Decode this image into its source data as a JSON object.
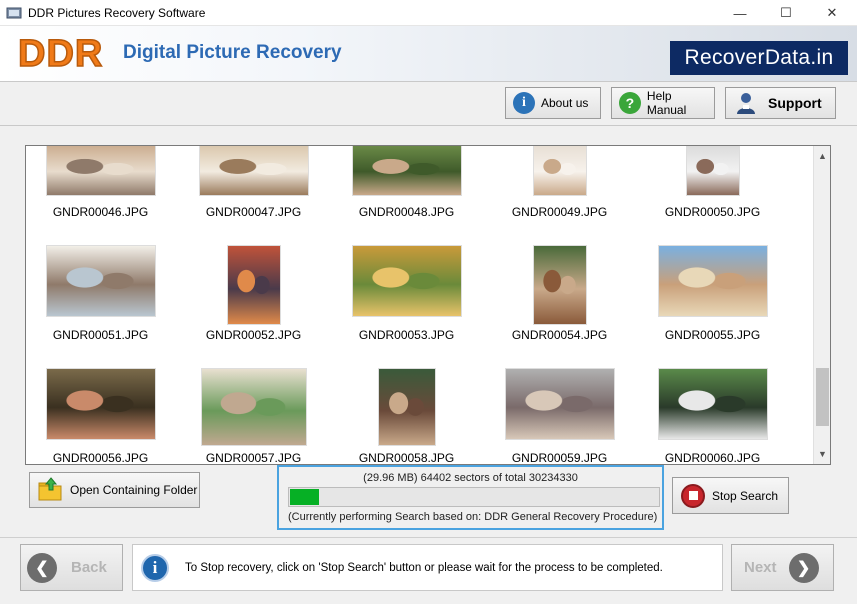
{
  "window": {
    "title": "DDR Pictures Recovery Software",
    "controls": {
      "minimize": "—",
      "maximize": "☐",
      "close": "✕"
    }
  },
  "banner": {
    "logo": "DDR",
    "product": "Digital Picture Recovery",
    "brand": "RecoverData.in",
    "logo_color": "#f07a18",
    "product_color": "#2d6ab4",
    "brand_bg": "#0d2a63"
  },
  "top_buttons": {
    "about": "About us",
    "help": "Help Manual",
    "support": "Support"
  },
  "gallery": {
    "rows": [
      [
        {
          "name": "GNDR00046.JPG",
          "icon": "photo-thumbnail"
        },
        {
          "name": "GNDR00047.JPG",
          "icon": "photo-thumbnail"
        },
        {
          "name": "GNDR00048.JPG",
          "icon": "photo-thumbnail"
        },
        {
          "name": "GNDR00049.JPG",
          "icon": "photo-thumbnail"
        },
        {
          "name": "GNDR00050.JPG",
          "icon": "photo-thumbnail"
        }
      ],
      [
        {
          "name": "GNDR00051.JPG",
          "icon": "photo-thumbnail"
        },
        {
          "name": "GNDR00052.JPG",
          "icon": "photo-thumbnail"
        },
        {
          "name": "GNDR00053.JPG",
          "icon": "photo-thumbnail"
        },
        {
          "name": "GNDR00054.JPG",
          "icon": "photo-thumbnail"
        },
        {
          "name": "GNDR00055.JPG",
          "icon": "photo-thumbnail"
        }
      ],
      [
        {
          "name": "GNDR00056.JPG",
          "icon": "photo-thumbnail"
        },
        {
          "name": "GNDR00057.JPG",
          "icon": "photo-thumbnail"
        },
        {
          "name": "GNDR00058.JPG",
          "icon": "photo-thumbnail"
        },
        {
          "name": "GNDR00059.JPG",
          "icon": "photo-thumbnail"
        },
        {
          "name": "GNDR00060.JPG",
          "icon": "photo-thumbnail"
        }
      ]
    ]
  },
  "controls": {
    "open_folder": "Open Containing Folder",
    "stop_search": "Stop Search"
  },
  "progress": {
    "stats": "(29.96 MB) 64402  sectors  of  total 30234330",
    "fraction": 0.08,
    "method": "(Currently performing Search based on:  DDR General Recovery Procedure)",
    "fill_color": "#06b025"
  },
  "footer": {
    "back": "Back",
    "next": "Next",
    "info": "To Stop recovery, click on 'Stop Search' button or please wait for the process to be completed."
  }
}
